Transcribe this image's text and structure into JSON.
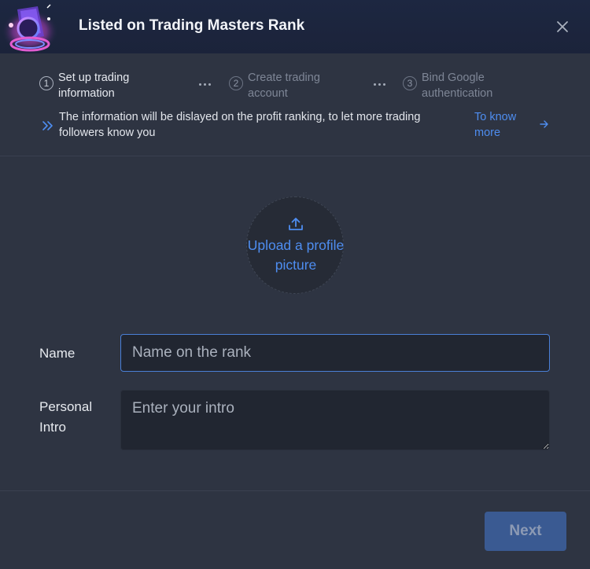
{
  "dialog": {
    "title": "Listed on Trading Masters Rank"
  },
  "steps": [
    {
      "number": "1",
      "label": "Set up trading information",
      "active": true
    },
    {
      "number": "2",
      "label": "Create trading account",
      "active": false
    },
    {
      "number": "3",
      "label": "Bind Google authentication",
      "active": false
    }
  ],
  "info": {
    "text": "The information will be dislayed on the profit ranking, to let more trading followers know you",
    "link": "To know more"
  },
  "upload": {
    "label": "Upload a profile picture"
  },
  "form": {
    "name_label": "Name",
    "name_placeholder": "Name on the rank",
    "intro_label": "Personal Intro",
    "intro_placeholder": "Enter your intro"
  },
  "footer": {
    "next_label": "Next"
  },
  "colors": {
    "accent": "#4e8df0",
    "background": "#2e3442",
    "header": "#1d2741",
    "next_disabled": "#3a5a92"
  },
  "icons": {
    "logo": "trading-masters-logo",
    "close": "close-icon",
    "info": "double-chevron-icon",
    "arrow": "arrow-right-icon",
    "upload": "upload-icon"
  }
}
